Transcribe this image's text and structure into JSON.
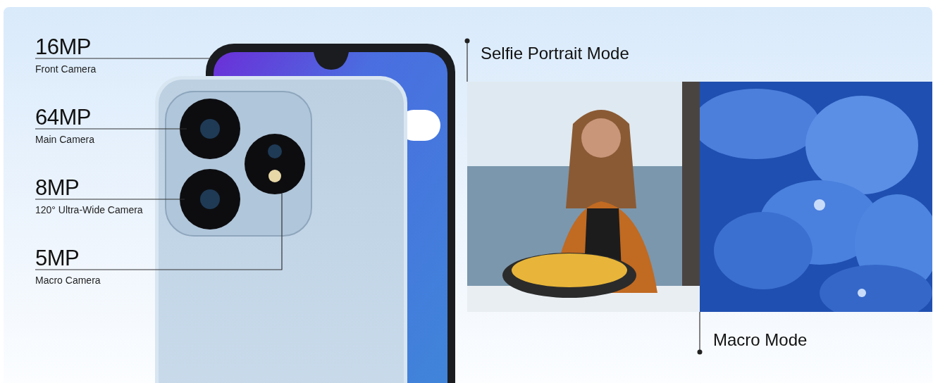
{
  "specs": [
    {
      "value": "16MP",
      "label": "Front Camera"
    },
    {
      "value": "64MP",
      "label": "Main Camera"
    },
    {
      "value": "8MP",
      "label": "120° Ultra-Wide Camera"
    },
    {
      "value": "5MP",
      "label": "Macro Camera"
    }
  ],
  "selfie_mode": "Selfie Portrait Mode",
  "macro_mode": "Macro Mode"
}
